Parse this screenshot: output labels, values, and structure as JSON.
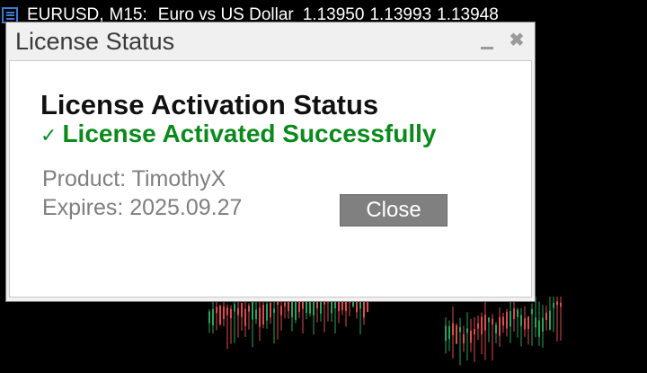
{
  "chart": {
    "symbol": "EURUSD",
    "timeframe": "M15",
    "description": "Euro vs US Dollar",
    "prices": [
      "1.13950",
      "1.13993",
      "1.13948"
    ],
    "bull_color": "#26a65b",
    "bear_color": "#e04a4a",
    "icons": {
      "menu": "chart-menu-icon"
    }
  },
  "dialog": {
    "title": "License Status",
    "heading": "License Activation Status",
    "status_icon": "✓",
    "status_text": "License Activated Successfully",
    "status_color": "#0b8a1c",
    "product_label": "Product:",
    "product_value": "TimothyX",
    "expires_label": "Expires:",
    "expires_value": "2025.09.27",
    "close_label": "Close",
    "minimize_glyph": "",
    "close_glyph": "✖",
    "icons": {
      "minimize": "minimize-icon",
      "close": "close-icon",
      "status": "checkmark-icon"
    }
  }
}
